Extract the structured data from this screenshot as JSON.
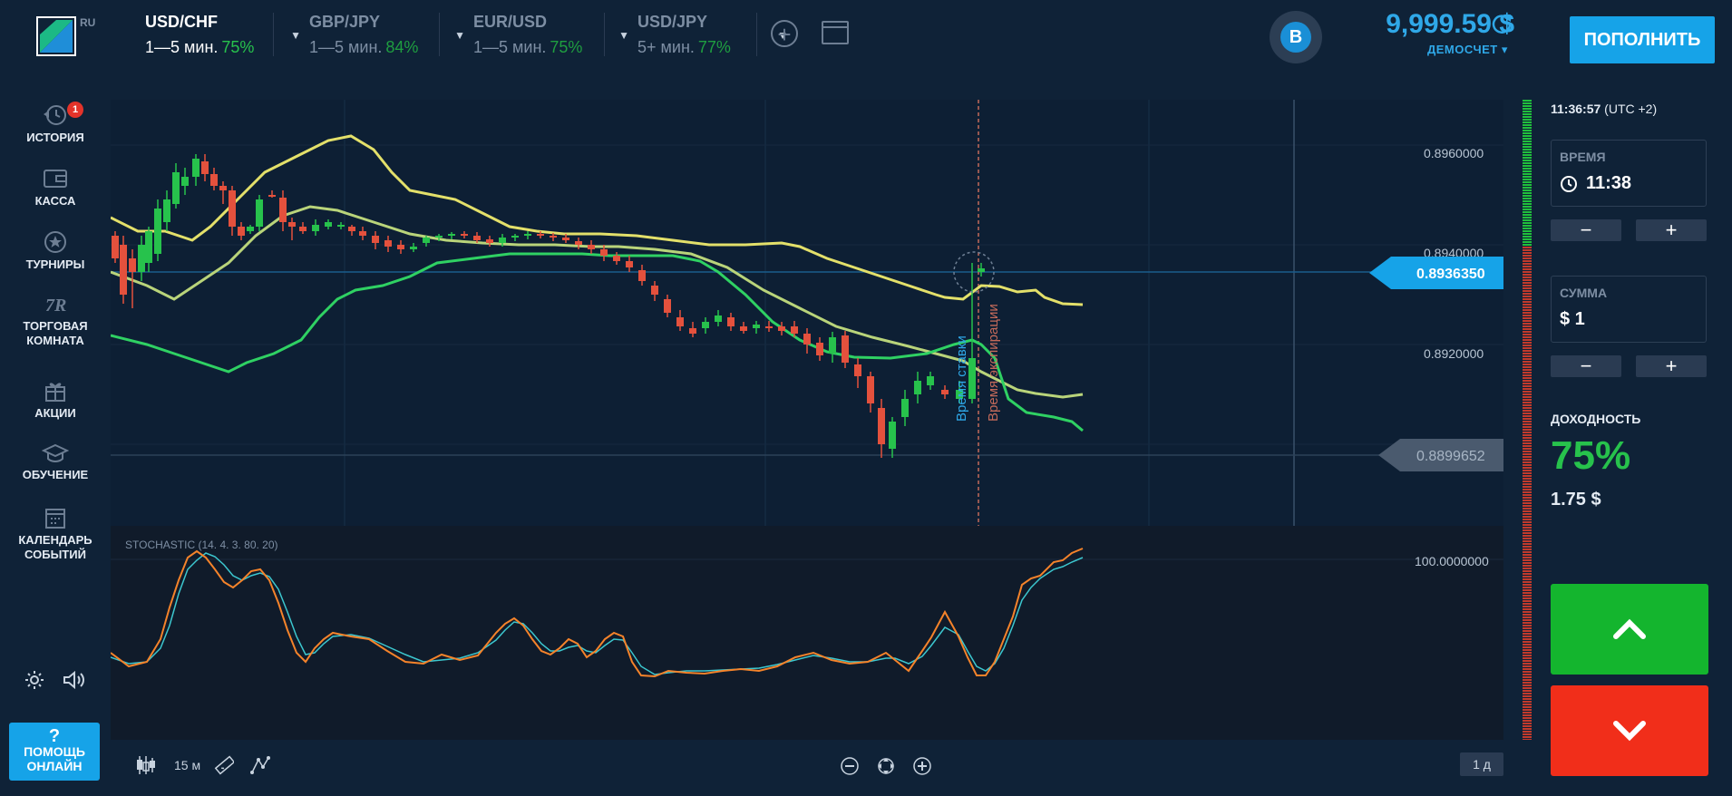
{
  "logo": {
    "region": "RU"
  },
  "pairs": [
    {
      "name": "USD/CHF",
      "duration": "1—5 мин.",
      "payout": "75%",
      "active": true
    },
    {
      "name": "GBP/JPY",
      "duration": "1—5 мин.",
      "payout": "84%",
      "active": false
    },
    {
      "name": "EUR/USD",
      "duration": "1—5 мин.",
      "payout": "75%",
      "active": false
    },
    {
      "name": "USD/JPY",
      "duration": "5+ мин.",
      "payout": "77%",
      "active": false
    }
  ],
  "account": {
    "avatar_letter": "B",
    "balance": "9,999.59 $",
    "type": "ДЕМОСЧЕТ",
    "deposit_label": "ПОПОЛНИТЬ"
  },
  "sidebar": {
    "items": [
      {
        "label": "ИСТОРИЯ",
        "icon": "history-icon"
      },
      {
        "label": "КАССА",
        "icon": "wallet-icon"
      },
      {
        "label": "ТУРНИРЫ",
        "icon": "star-icon"
      },
      {
        "label": "ТОРГОВАЯ КОМНАТА",
        "icon": "trading-room-icon"
      },
      {
        "label": "АКЦИИ",
        "icon": "gift-icon"
      },
      {
        "label": "ОБУЧЕНИЕ",
        "icon": "graduation-cap-icon"
      },
      {
        "label": "КАЛЕНДАРЬ СОБЫТИЙ",
        "icon": "calendar-icon"
      }
    ],
    "history_badge": "1",
    "help_icon": "?",
    "help_label": "ПОМОЩЬ ОНЛАЙН"
  },
  "chart": {
    "price_ticks": [
      "0.8960000",
      "0.8940000",
      "0.8920000"
    ],
    "current_price": "0.8936350",
    "low_price": "0.8899652",
    "bet_time_label": "Время ставки",
    "expiry_time_label": "Время экспирации",
    "oscillator_label": "STOCHASTIC (14. 4. 3. 80. 20)",
    "oscillator_top": "100.0000000",
    "colors": {
      "bull": "#27c24c",
      "bear": "#e4513d",
      "band_upper": "#e3e06a",
      "band_mid": "#b9d47a",
      "band_lower": "#2fd163",
      "stoch_k": "#f5832a",
      "stoch_d": "#3cc7cf"
    }
  },
  "toolbar": {
    "timeframe": "15 м",
    "period": "1 д"
  },
  "right_panel": {
    "clock_time": "11:36:57",
    "clock_tz": "(UTC +2)",
    "time_label": "ВРЕМЯ",
    "time_value": "11:38",
    "amount_label": "СУММА",
    "amount_value": "$ 1",
    "payout_label": "ДОХОДНОСТЬ",
    "payout_pct": "75%",
    "payout_amount": "1.75 $"
  }
}
